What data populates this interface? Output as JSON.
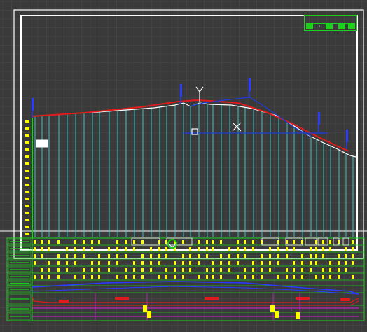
{
  "colors": {
    "background": "#3a3a3a",
    "grid_line": "#4a4a4a",
    "frame": "#ffffff",
    "ground_line": "#ffffff",
    "design_line": "#e11b1b",
    "alt_line": "#1d3cd8",
    "station_line": "#33d6d6",
    "table_green": "#19d219",
    "label_yellow": "#ffff00",
    "magenta": "#d41fd4",
    "table_blue": "#2a3cff"
  },
  "title_block": {
    "label": "",
    "page": "1"
  },
  "icons": [
    "ucs-y-axis-icon",
    "crosshair-x-icon",
    "pick-box-icon",
    "layout-marker-icon"
  ]
}
